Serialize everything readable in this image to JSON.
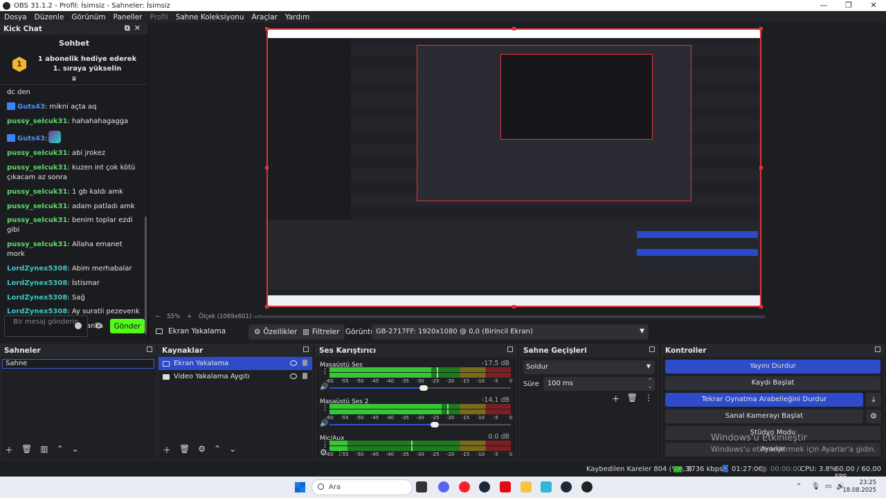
{
  "window": {
    "title": "OBS 31.1.2 - Profil: İsimsiz - Sahneler: İsimsiz",
    "minimize": "—",
    "restore": "❐",
    "close": "✕"
  },
  "menu": [
    "Dosya",
    "Düzenle",
    "Görünüm",
    "Paneller",
    "Profil",
    "Sahne Koleksiyonu",
    "Araçlar",
    "Yardım"
  ],
  "chat": {
    "dock_title": "Kick Chat",
    "title": "Sohbet",
    "pinned": "1 abonelik hediye ederek 1. sıraya yükselin",
    "pinned_rank": "1",
    "messages": [
      {
        "user": "",
        "text": "dc den",
        "color": "#e6e6e6"
      },
      {
        "user": "Guts43",
        "text": ": mikni açta aq",
        "color": "#4f8ff7",
        "badge": true
      },
      {
        "user": "pussy_selcuk31",
        "text": ": hahahahagagga",
        "color": "#5fd86b"
      },
      {
        "user": "Guts43",
        "text": ":",
        "color": "#4f8ff7",
        "badge": true,
        "emote": true
      },
      {
        "user": "pussy_selcuk31",
        "text": ": abi jrokez",
        "color": "#5fd86b"
      },
      {
        "user": "pussy_selcuk31",
        "text": ": kuzen int çok kötü çıkacam az sonra",
        "color": "#5fd86b"
      },
      {
        "user": "pussy_selcuk31",
        "text": ": 1 gb kaldı amk",
        "color": "#5fd86b"
      },
      {
        "user": "pussy_selcuk31",
        "text": ": adam patladı amk",
        "color": "#5fd86b"
      },
      {
        "user": "pussy_selcuk31",
        "text": ": benim toplar ezdi gibi",
        "color": "#5fd86b"
      },
      {
        "user": "pussy_selcuk31",
        "text": ": Allaha emanet mork",
        "color": "#5fd86b"
      },
      {
        "user": "LordZynex5308",
        "text": ": Abim merhabalar",
        "color": "#3fc6c6"
      },
      {
        "user": "LordZynex5308",
        "text": ": İstismar",
        "color": "#3fc6c6"
      },
      {
        "user": "LordZynex5308",
        "text": ": Sağ",
        "color": "#3fc6c6"
      },
      {
        "user": "LordZynex5308",
        "text": ": Ay suratli pezevenk",
        "color": "#3fc6c6"
      },
      {
        "user": "LordZynex5308",
        "text": ": Ac kanka",
        "color": "#3fc6c6"
      }
    ],
    "input_placeholder": "Bir mesaj gönderin",
    "send": "Gönder"
  },
  "preview": {
    "zoom": "55%",
    "scale": "Ölçek (1069x601)",
    "minus": "−",
    "plus": "+",
    "watermark_1": "Windows'u Etkinleştir",
    "watermark_2": "Windows'u etkinleştirmek için Ayarlar'a gidin."
  },
  "context": {
    "source": "Ekran Yakalama",
    "properties": "Özellikler",
    "filters": "Filtreler",
    "display_label": "Görüntü",
    "display_value": "GB-2717FF: 1920x1080 @ 0,0 (Birincil Ekran)"
  },
  "scenes": {
    "title": "Sahneler",
    "items": [
      "Sahne"
    ]
  },
  "sources": {
    "title": "Kaynaklar",
    "items": [
      "Ekran Yakalama",
      "Video Yakalama Aygıtı"
    ]
  },
  "mixer": {
    "title": "Ses Karıştırıcı",
    "ticks": [
      "-60",
      "-55",
      "-50",
      "-45",
      "-40",
      "-35",
      "-30",
      "-25",
      "-20",
      "-15",
      "-10",
      "-5",
      "0"
    ],
    "channels": [
      {
        "name": "Masaüstü Ses",
        "db": "-17.5 dB",
        "level": 0.56,
        "peak": 0.59,
        "volume": 0.52
      },
      {
        "name": "Masaüstü Ses 2",
        "db": "-14.1 dB",
        "level": 0.62,
        "peak": 0.65,
        "volume": 0.58
      },
      {
        "name": "Mic/Aux",
        "db": "0.0 dB",
        "level": 0.1,
        "peak": 0.45,
        "volume": 1.0
      }
    ]
  },
  "transitions": {
    "title": "Sahne Geçişleri",
    "type": "Soldur",
    "duration_label": "Süre",
    "duration": "100 ms"
  },
  "controls": {
    "title": "Kontroller",
    "stop_stream": "Yayını Durdur",
    "start_record": "Kaydı Başlat",
    "stop_replay": "Tekrar Oynatma Arabelleğini Durdur",
    "virtual_cam": "Sanal Kamerayı Başlat",
    "studio_mode": "Stüdyo Modu",
    "settings": "Ayarlar"
  },
  "status": {
    "dropped": "Kaybedilen Kareler 804 (%0,3)",
    "kbps": "3736 kbps",
    "stream_time": "01:27:06",
    "record_time": "00:00:00",
    "cpu": "CPU: 3.8%",
    "fps": "60.00 / 60.00 FPS"
  },
  "taskbar": {
    "search": "Ara",
    "time": "23:25",
    "date": "18.08.2025"
  },
  "colors": {
    "accent": "#2e4bc9",
    "kick_green": "#53fc18",
    "selection_red": "#e3323a"
  }
}
